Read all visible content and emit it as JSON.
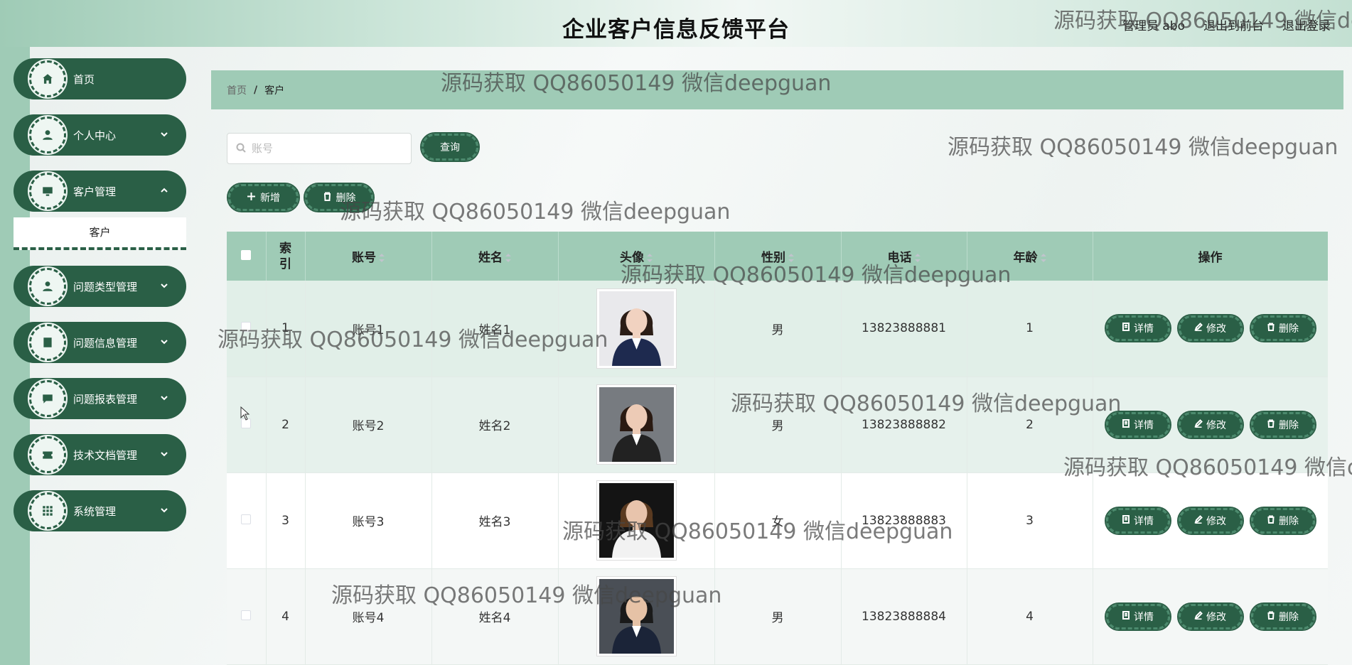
{
  "header": {
    "title": "企业客户信息反馈平台",
    "user_label": "管理员 abo",
    "front_label": "退出到前台",
    "logout_label": "退出登录"
  },
  "sidebar": {
    "items": [
      {
        "label": "首页",
        "icon": "home-icon"
      },
      {
        "label": "个人中心",
        "icon": "user-icon"
      },
      {
        "label": "客户管理",
        "icon": "monitor-icon"
      },
      {
        "label": "问题类型管理",
        "icon": "user-icon"
      },
      {
        "label": "问题信息管理",
        "icon": "document-icon"
      },
      {
        "label": "问题报表管理",
        "icon": "chat-icon"
      },
      {
        "label": "技术文档管理",
        "icon": "ticket-icon"
      },
      {
        "label": "系统管理",
        "icon": "grid-icon"
      }
    ],
    "submenu": {
      "label": "客户"
    }
  },
  "breadcrumb": {
    "home": "首页",
    "separator": "/",
    "current": "客户"
  },
  "search": {
    "placeholder": "账号",
    "button_label": "查询"
  },
  "actions": {
    "add_label": "新增",
    "delete_label": "删除"
  },
  "table": {
    "headers": [
      "索引",
      "账号",
      "姓名",
      "头像",
      "性别",
      "电话",
      "年龄",
      "操作"
    ],
    "rows": [
      {
        "index": "1",
        "account": "账号1",
        "name": "姓名1",
        "gender": "男",
        "phone": "13823888881",
        "age": "1"
      },
      {
        "index": "2",
        "account": "账号2",
        "name": "姓名2",
        "gender": "男",
        "phone": "13823888882",
        "age": "2"
      },
      {
        "index": "3",
        "account": "账号3",
        "name": "姓名3",
        "gender": "女",
        "phone": "13823888883",
        "age": "3"
      },
      {
        "index": "4",
        "account": "账号4",
        "name": "姓名4",
        "gender": "男",
        "phone": "13823888884",
        "age": "4"
      }
    ],
    "ops": {
      "detail": "详情",
      "edit": "修改",
      "delete": "删除"
    }
  },
  "watermark": "源码获取 QQ86050149 微信deepguan",
  "colors": {
    "primary": "#2a5f46",
    "accent": "#9fcbb6"
  }
}
